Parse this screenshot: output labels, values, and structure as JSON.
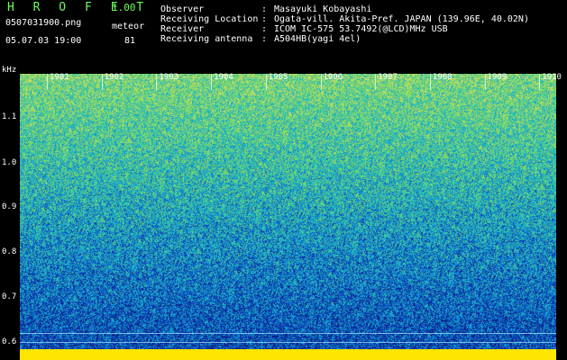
{
  "header": {
    "app_name": "H R O F F T",
    "app_version": "1.00",
    "file_name": "0507031900.png",
    "meteor_label": "meteor",
    "datetime": "05.07.03 19:00",
    "meteor_count": "81"
  },
  "info": [
    {
      "key": "Observer",
      "value": "Masayuki Kobayashi"
    },
    {
      "key": "Receiving Location",
      "value": "Ogata-vill. Akita-Pref. JAPAN (139.96E, 40.02N)"
    },
    {
      "key": "Receiver",
      "value": "ICOM IC-575 53.7492(@LCD)MHz USB"
    },
    {
      "key": "Receiving antenna",
      "value": "A504HB(yagi 4el)"
    }
  ],
  "axis": {
    "y_unit": "kHz",
    "y_ticks": [
      "1.1",
      "1.0",
      "0.9",
      "0.8",
      "0.7",
      "0.6"
    ],
    "x_ticks": [
      "1901",
      "1902",
      "1903",
      "1904",
      "1905",
      "1906",
      "1907",
      "1908",
      "1909",
      "1910"
    ]
  },
  "colors": {
    "background": "#000000",
    "title_green": "#6cff5a",
    "noise_low": "#0a1fb0",
    "noise_mid": "#1fa0c8",
    "noise_high": "#9fe060",
    "baseline_yellow": "#ffe600"
  }
}
